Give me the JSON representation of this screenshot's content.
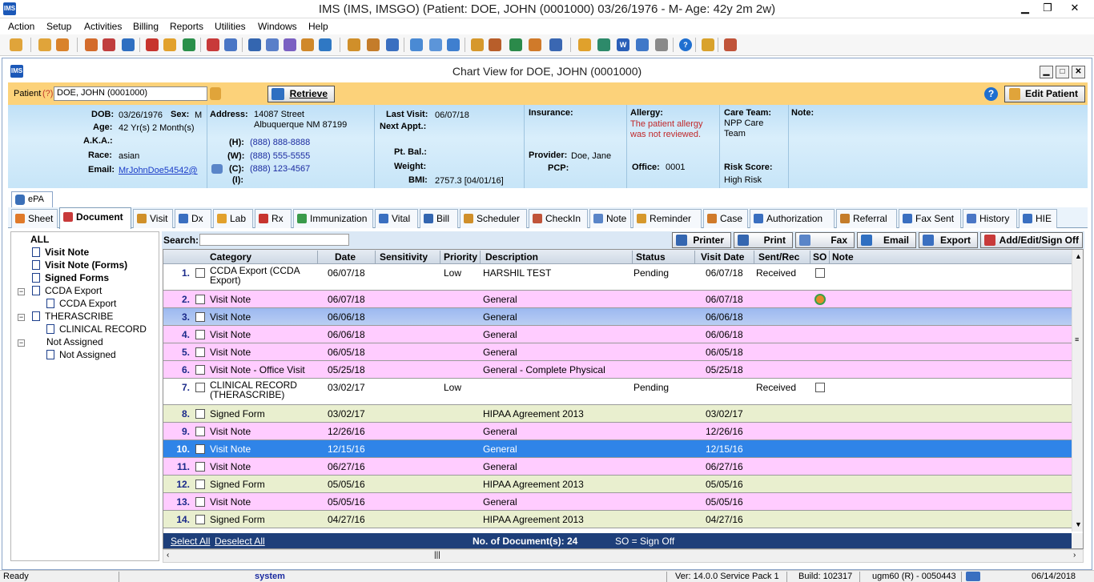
{
  "window": {
    "title": "IMS (IMS, IMSGO)    (Patient: DOE, JOHN  (0001000) 03/26/1976  - M-  Age: 42y 2m 2w)",
    "minimize": "▁",
    "restore": "❐",
    "close": "✕"
  },
  "menu": [
    "Action",
    "Setup",
    "Activities",
    "Billing",
    "Reports",
    "Utilities",
    "Windows",
    "Help"
  ],
  "chart_window": {
    "title": "Chart View for DOE, JOHN  (0001000)"
  },
  "patient_bar": {
    "label": "Patient",
    "help_mark": "(?)",
    "patient_value": "DOE, JOHN  (0001000)",
    "retrieve": "Retrieve",
    "edit_patient": "Edit Patient"
  },
  "info": {
    "dob_label": "DOB:",
    "dob": "03/26/1976",
    "sex_label": "Sex:",
    "sex": "M",
    "age_label": "Age:",
    "age": "42 Yr(s) 2 Month(s)",
    "aka_label": "A.K.A.:",
    "race_label": "Race:",
    "race": "asian",
    "email_label": "Email:",
    "email": "MrJohnDoe54542@",
    "address_label": "Address:",
    "address1": "14087 Street",
    "address2": "Albuquerque  NM  87199",
    "home_label": "(H):",
    "home": "(888) 888-8888",
    "work_label": "(W):",
    "work": "(888) 555-5555",
    "cell_label": "(C):",
    "cell": "(888) 123-4567",
    "i_label": "(I):",
    "last_visit_label": "Last Visit:",
    "last_visit": "06/07/18",
    "next_appt_label": "Next Appt.:",
    "pt_bal_label": "Pt. Bal.:",
    "weight_label": "Weight:",
    "bmi_label": "BMI:",
    "bmi": "2757.3 [04/01/16]",
    "insurance_label": "Insurance:",
    "provider_label": "Provider:",
    "provider": "Doe, Jane",
    "pcp_label": "PCP:",
    "allergy_label": "Allergy:",
    "allergy_text1": "The patient allergy",
    "allergy_text2": "was not reviewed.",
    "office_label": "Office:",
    "office": "0001",
    "care_team_label": "Care Team:",
    "care_team1": "NPP  Care",
    "care_team2": "Team",
    "risk_label": "Risk Score:",
    "risk": "High Risk",
    "note_label": "Note:"
  },
  "epa_tab": "ePA",
  "tabs": [
    "Sheet",
    "Document",
    "Visit",
    "Dx",
    "Lab",
    "Rx",
    "Immunization",
    "Vital",
    "Bill",
    "Scheduler",
    "CheckIn",
    "Note",
    "Reminder",
    "Case",
    "Authorization",
    "Referral",
    "Fax Sent",
    "History",
    "HIE"
  ],
  "tree": {
    "all": "ALL",
    "visit_note": "Visit Note",
    "visit_note_forms": "Visit Note (Forms)",
    "signed_forms": "Signed Forms",
    "ccda_export": "CCDA Export",
    "ccda_export_child": "CCDA Export",
    "therascribe": "THERASCRIBE",
    "clinical_record": "CLINICAL RECORD",
    "not_assigned": "Not Assigned",
    "not_assigned_child": "Not Assigned"
  },
  "search_label": "Search:",
  "actions": {
    "printer": "Printer",
    "print": "Print",
    "fax": "Fax",
    "email": "Email",
    "export": "Export",
    "add_edit": "Add/Edit/Sign Off"
  },
  "columns": [
    "Category",
    "Date",
    "Sensitivity",
    "Priority",
    "Description",
    "Status",
    "Visit Date",
    "Sent/Rec",
    "SO",
    "Note"
  ],
  "rows": [
    {
      "n": "1.",
      "category": "CCDA Export (CCDA Export)",
      "date": "06/07/18",
      "sensitivity": "",
      "priority": "Low",
      "description": "HARSHIL TEST",
      "status": "Pending",
      "visit_date": "06/07/18",
      "sent": "Received"
    },
    {
      "n": "2.",
      "category": "Visit Note",
      "date": "06/07/18",
      "sensitivity": "",
      "priority": "",
      "description": "General",
      "status": "",
      "visit_date": "06/07/18",
      "sent": ""
    },
    {
      "n": "3.",
      "category": "Visit Note",
      "date": "06/06/18",
      "sensitivity": "",
      "priority": "",
      "description": "General",
      "status": "",
      "visit_date": "06/06/18",
      "sent": ""
    },
    {
      "n": "4.",
      "category": "Visit Note",
      "date": "06/06/18",
      "sensitivity": "",
      "priority": "",
      "description": "General",
      "status": "",
      "visit_date": "06/06/18",
      "sent": ""
    },
    {
      "n": "5.",
      "category": "Visit Note",
      "date": "06/05/18",
      "sensitivity": "",
      "priority": "",
      "description": "General",
      "status": "",
      "visit_date": "06/05/18",
      "sent": ""
    },
    {
      "n": "6.",
      "category": "Visit Note - Office Visit",
      "date": "05/25/18",
      "sensitivity": "",
      "priority": "",
      "description": "General - Complete Physical",
      "status": "",
      "visit_date": "05/25/18",
      "sent": ""
    },
    {
      "n": "7.",
      "category": "CLINICAL RECORD (THERASCRIBE)",
      "date": "03/02/17",
      "sensitivity": "",
      "priority": "Low",
      "description": "",
      "status": "Pending",
      "visit_date": "",
      "sent": "Received"
    },
    {
      "n": "8.",
      "category": "Signed Form",
      "date": "03/02/17",
      "sensitivity": "",
      "priority": "",
      "description": "HIPAA Agreement 2013",
      "status": "",
      "visit_date": "03/02/17",
      "sent": ""
    },
    {
      "n": "9.",
      "category": "Visit Note",
      "date": "12/26/16",
      "sensitivity": "",
      "priority": "",
      "description": "General",
      "status": "",
      "visit_date": "12/26/16",
      "sent": ""
    },
    {
      "n": "10.",
      "category": "Visit Note",
      "date": "12/15/16",
      "sensitivity": "",
      "priority": "",
      "description": "General",
      "status": "",
      "visit_date": "12/15/16",
      "sent": ""
    },
    {
      "n": "11.",
      "category": "Visit Note",
      "date": "06/27/16",
      "sensitivity": "",
      "priority": "",
      "description": "General",
      "status": "",
      "visit_date": "06/27/16",
      "sent": ""
    },
    {
      "n": "12.",
      "category": "Signed Form",
      "date": "05/05/16",
      "sensitivity": "",
      "priority": "",
      "description": "HIPAA Agreement 2013",
      "status": "",
      "visit_date": "05/05/16",
      "sent": ""
    },
    {
      "n": "13.",
      "category": "Visit Note",
      "date": "05/05/16",
      "sensitivity": "",
      "priority": "",
      "description": "General",
      "status": "",
      "visit_date": "05/05/16",
      "sent": ""
    },
    {
      "n": "14.",
      "category": "Signed Form",
      "date": "04/27/16",
      "sensitivity": "",
      "priority": "",
      "description": "HIPAA Agreement 2013",
      "status": "",
      "visit_date": "04/27/16",
      "sent": ""
    }
  ],
  "footer": {
    "select_all": "Select All",
    "deselect_all": "Deselect All",
    "count": "No. of Document(s): 24",
    "so_legend": "SO = Sign Off"
  },
  "status": {
    "ready": "Ready",
    "user": "system",
    "version": "Ver: 14.0.0 Service Pack 1",
    "build": "Build: 102317",
    "server": "ugm60 (R) - 0050443",
    "date": "06/14/2018"
  },
  "colors": {
    "visit_note_row": "#ffccff",
    "signed_form_row": "#e9efcf",
    "selected_row": "#2f84e8",
    "selected_row_light": "#9cb8f0",
    "patient_bar": "#fcd27a",
    "info_panel": "#c7e5f8"
  }
}
